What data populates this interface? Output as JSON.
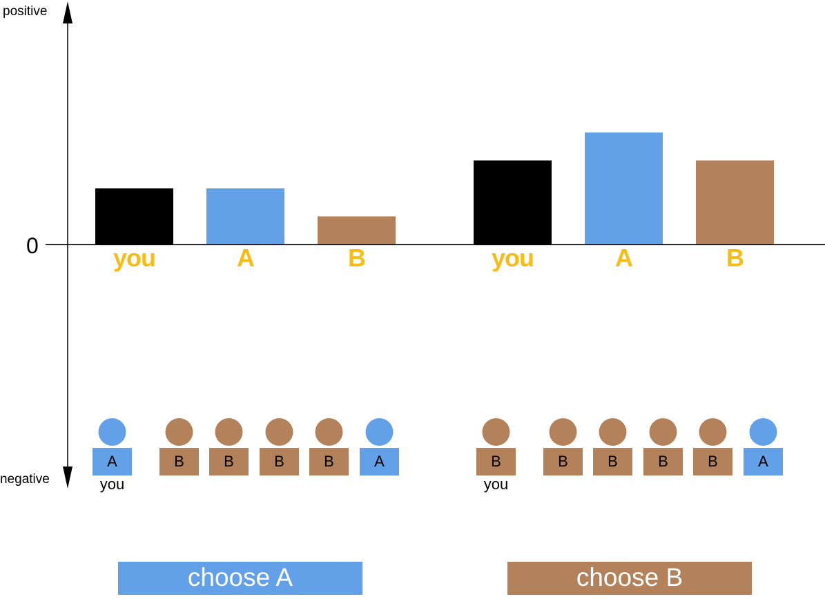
{
  "axis": {
    "top_label": "positive",
    "bottom_label": "negative",
    "zero_label": "0"
  },
  "colors": {
    "you": "#000000",
    "A": "#62A0E8",
    "B": "#B3825A",
    "bar_label": "#F9BC15",
    "axis": "#000000",
    "button_text": "#ffffff"
  },
  "chart_data": [
    {
      "type": "bar",
      "group": "choose A",
      "categories": [
        "you",
        "A",
        "B"
      ],
      "values": [
        2,
        2,
        1
      ],
      "y_scale": "qualitative",
      "title": "",
      "xlabel": "",
      "ylabel": ""
    },
    {
      "type": "bar",
      "group": "choose B",
      "categories": [
        "you",
        "A",
        "B"
      ],
      "values": [
        3,
        4,
        3
      ],
      "y_scale": "qualitative",
      "title": "",
      "xlabel": "",
      "ylabel": ""
    }
  ],
  "groups": [
    {
      "people": [
        {
          "team": "A",
          "label": "A"
        },
        {
          "team": "B",
          "label": "B"
        },
        {
          "team": "B",
          "label": "B"
        },
        {
          "team": "B",
          "label": "B"
        },
        {
          "team": "B",
          "label": "B"
        },
        {
          "team": "A",
          "label": "A"
        }
      ],
      "you_label": "you",
      "button": {
        "label": "choose A",
        "team": "A"
      }
    },
    {
      "people": [
        {
          "team": "B",
          "label": "B"
        },
        {
          "team": "B",
          "label": "B"
        },
        {
          "team": "B",
          "label": "B"
        },
        {
          "team": "B",
          "label": "B"
        },
        {
          "team": "B",
          "label": "B"
        },
        {
          "team": "A",
          "label": "A"
        }
      ],
      "you_label": "you",
      "button": {
        "label": "choose B",
        "team": "B"
      }
    }
  ]
}
